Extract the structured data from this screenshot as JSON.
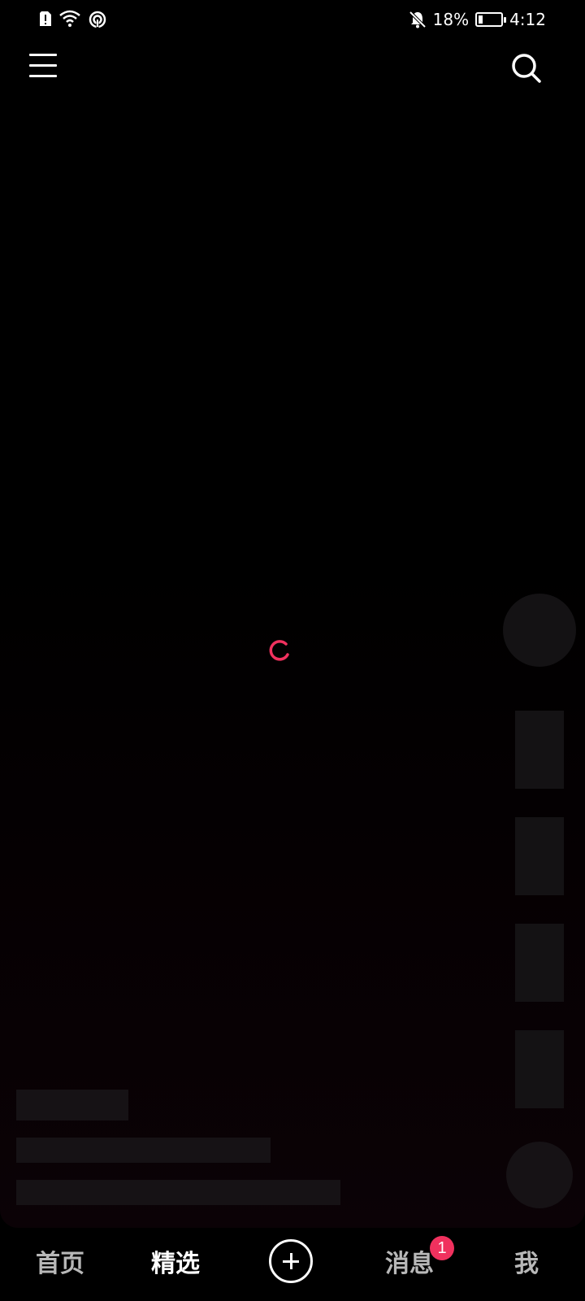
{
  "status_bar": {
    "left_icons": [
      "sim-alert-icon",
      "wifi-icon",
      "hotspot-icon"
    ],
    "notifications_muted_icon": "bell-off-icon",
    "battery_percent": "18%",
    "battery_level": 0.18,
    "charging": true,
    "time": "4:12"
  },
  "top_bar": {
    "menu_icon": "hamburger-menu-icon",
    "search_icon": "search-icon"
  },
  "loading": {
    "spinner_color": "#f0315e"
  },
  "bottom_nav": {
    "items": [
      {
        "label": "首页",
        "active": false
      },
      {
        "label": "精选",
        "active": true
      },
      {
        "label": "",
        "icon": "plus-circle-icon"
      },
      {
        "label": "消息",
        "active": false,
        "badge": "1"
      },
      {
        "label": "我",
        "active": false
      }
    ]
  },
  "colors": {
    "accent": "#f0315e",
    "background": "#000000",
    "skeleton": "#141214"
  }
}
